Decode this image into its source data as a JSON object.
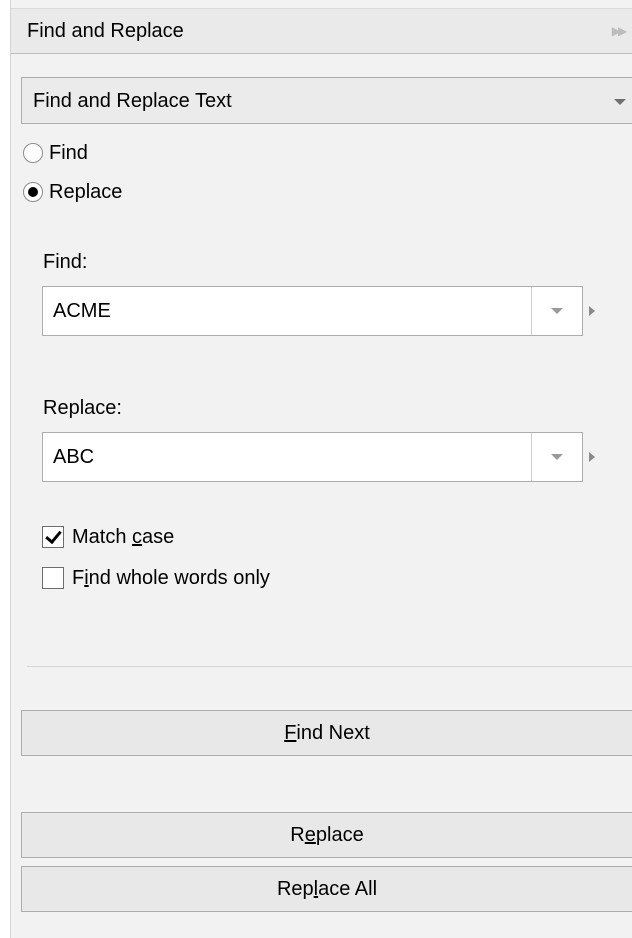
{
  "panel": {
    "title": "Find and Replace"
  },
  "mode": {
    "selected": "Find and Replace Text"
  },
  "radio": {
    "find": {
      "label": "Find",
      "checked": false
    },
    "replace": {
      "label": "Replace",
      "checked": true
    }
  },
  "find_field": {
    "label": "Find:",
    "value": "ACME"
  },
  "replace_field": {
    "label": "Replace:",
    "value": "ABC"
  },
  "options": {
    "match_case": {
      "pre": "Match ",
      "accel": "c",
      "post": "ase",
      "checked": true
    },
    "whole_words": {
      "pre": "F",
      "accel": "i",
      "post": "nd whole words only",
      "checked": false
    }
  },
  "buttons": {
    "find_next": {
      "pre": "",
      "accel": "F",
      "post": "ind Next"
    },
    "replace": {
      "pre": "R",
      "accel": "e",
      "post": "place"
    },
    "replace_all": {
      "pre": "Rep",
      "accel": "l",
      "post": "ace All"
    }
  },
  "icons": {
    "expand": "double-chevron-right-icon",
    "dropdown": "caret-down-icon",
    "options": "caret-right-icon"
  }
}
